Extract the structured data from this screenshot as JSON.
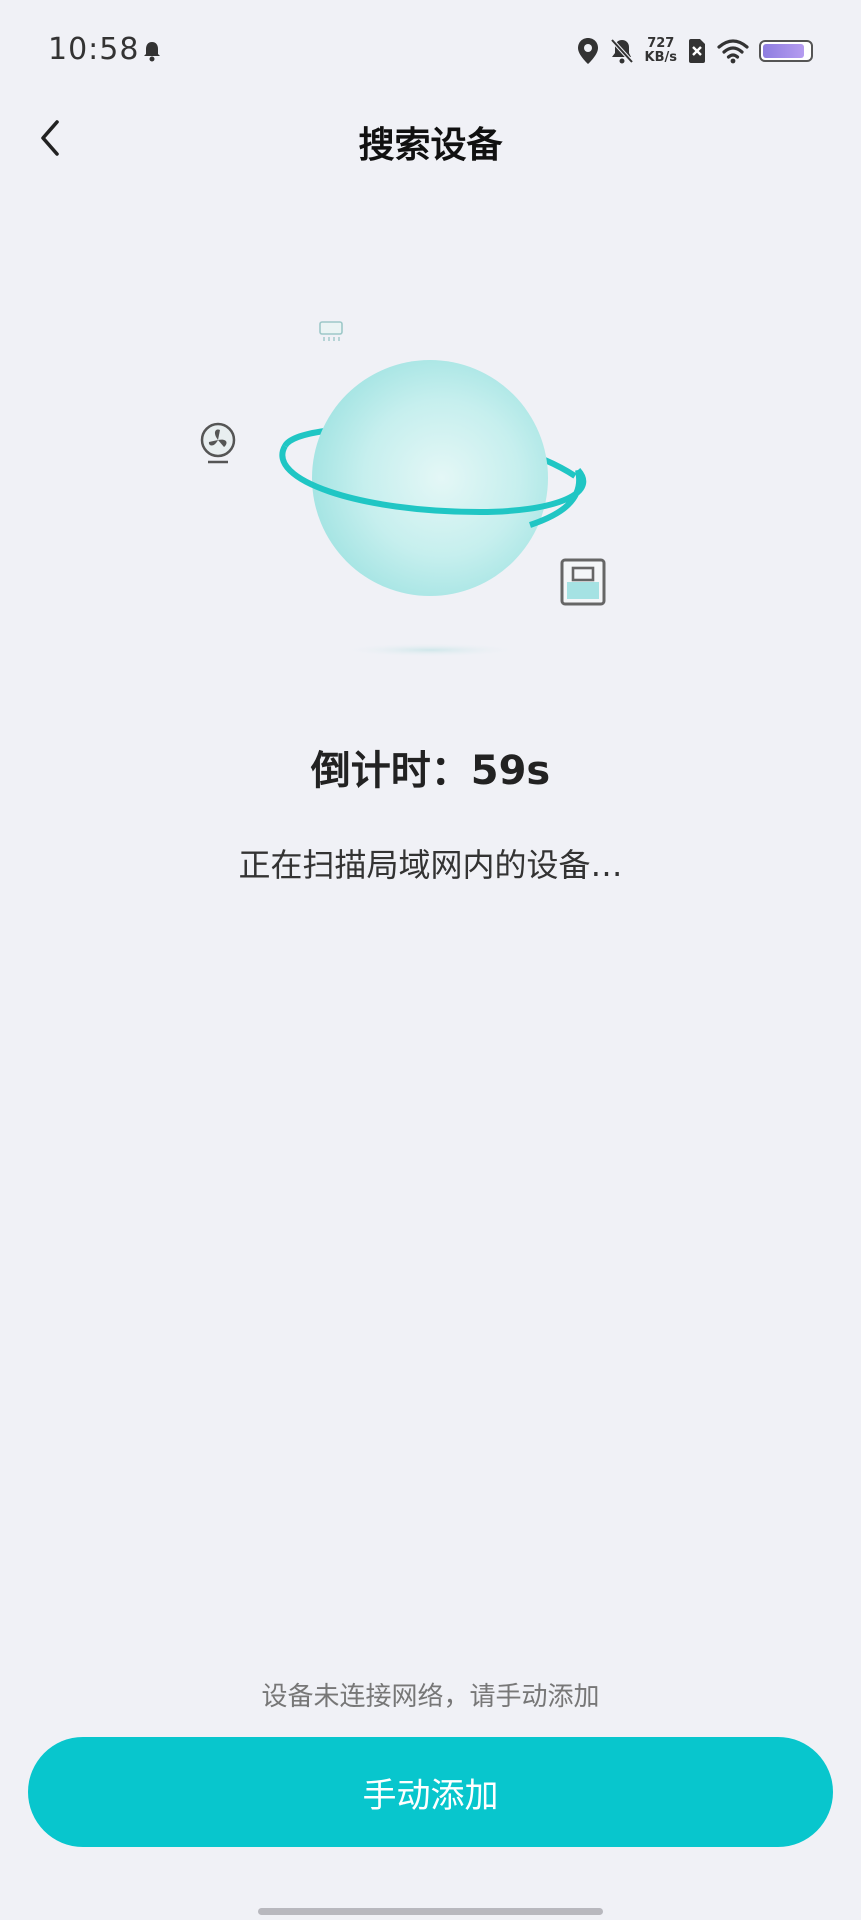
{
  "status_bar": {
    "time": "10:58",
    "net_speed_value": "727",
    "net_speed_unit": "KB/s",
    "battery_level": 0.9,
    "icons": [
      "bell-icon",
      "location-icon",
      "mute-icon",
      "sim-blocked-icon",
      "wifi-icon",
      "battery-icon"
    ]
  },
  "header": {
    "title": "搜索设备",
    "back_icon": "chevron-left-icon"
  },
  "illustration": {
    "icons": [
      "planet-icon",
      "fan-icon",
      "air-conditioner-icon",
      "switch-panel-icon"
    ],
    "colors": {
      "accent": "#08c6cd",
      "planet": "#bdeeee"
    }
  },
  "scan": {
    "countdown": "倒计时：59s",
    "status": "正在扫描局域网内的设备…"
  },
  "footer": {
    "hint": "设备未连接网络，请手动添加",
    "manual_add_label": "手动添加"
  },
  "colors": {
    "background": "#f0f1f6",
    "primary": "#08c6cd"
  }
}
